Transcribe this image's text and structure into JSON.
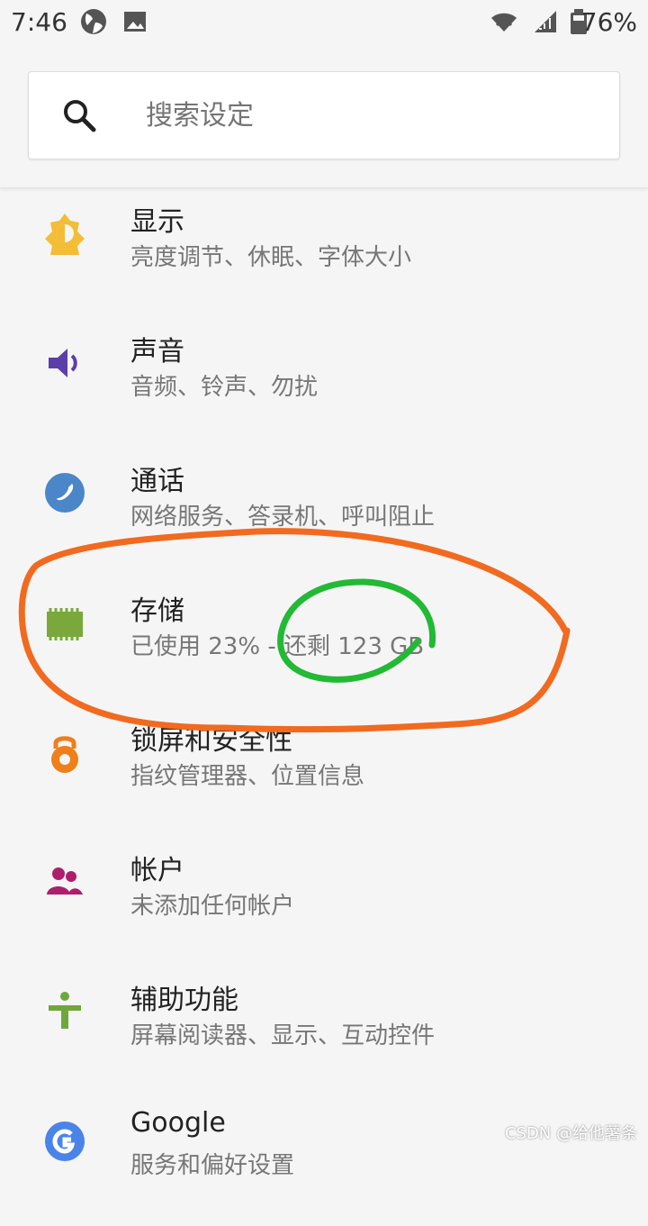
{
  "status": {
    "time": "7:46",
    "battery": "76%"
  },
  "search": {
    "placeholder": "搜索设定"
  },
  "settings": [
    {
      "title": "显示",
      "subtitle": "亮度调节、休眠、字体大小",
      "icon": "display-icon"
    },
    {
      "title": "声音",
      "subtitle": "音频、铃声、勿扰",
      "icon": "sound-icon"
    },
    {
      "title": "通话",
      "subtitle": "网络服务、答录机、呼叫阻止",
      "icon": "phone-icon"
    },
    {
      "title": "存储",
      "subtitle": "已使用 23% - 还剩 123 GB",
      "icon": "storage-icon"
    },
    {
      "title": "锁屏和安全性",
      "subtitle": "指纹管理器、位置信息",
      "icon": "lock-icon"
    },
    {
      "title": "帐户",
      "subtitle": "未添加任何帐户",
      "icon": "account-icon"
    },
    {
      "title": "辅助功能",
      "subtitle": "屏幕阅读器、显示、互动控件",
      "icon": "accessibility-icon"
    },
    {
      "title": "Google",
      "subtitle": "服务和偏好设置",
      "icon": "google-icon"
    }
  ],
  "colors": {
    "display": "#f4bd36",
    "sound": "#5b3ea8",
    "call": "#4b86c8",
    "storage": "#7aa83a",
    "lock": "#ef7f1a",
    "account": "#ad1f6d",
    "accessibility": "#6fa83a",
    "google": "#4a84e8",
    "annotation_orange": "#f16a1f",
    "annotation_green": "#22b935"
  },
  "watermark": "CSDN @给他薯条"
}
